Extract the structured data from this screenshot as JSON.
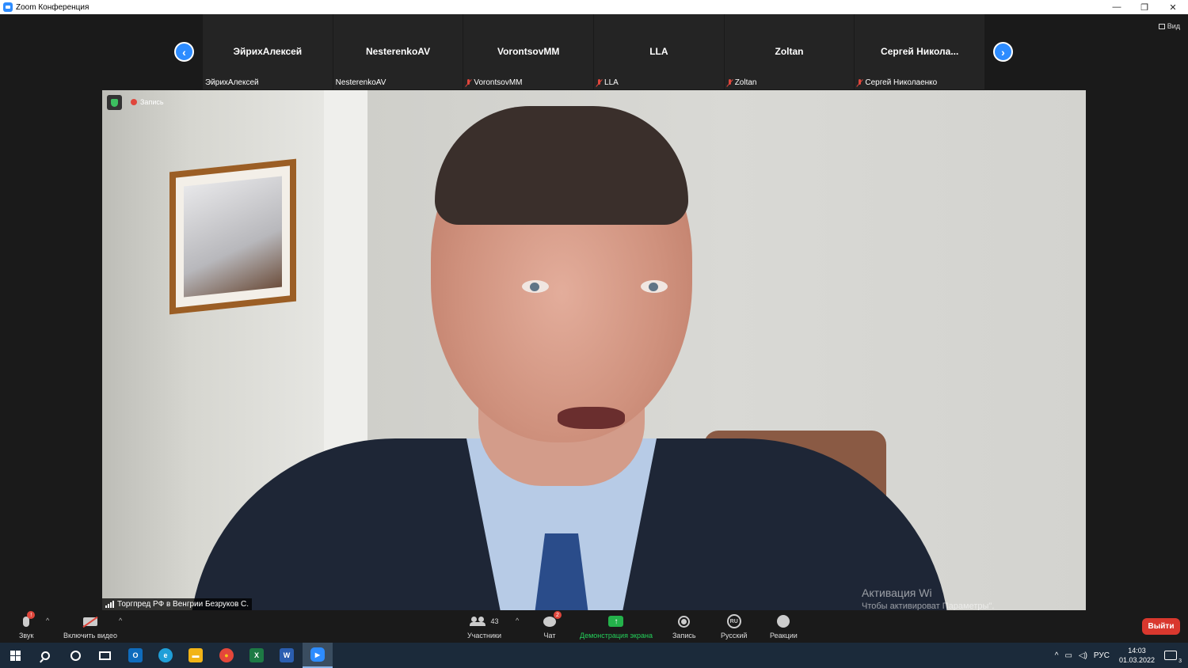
{
  "window": {
    "title": "Zoom Конференция",
    "controls": {
      "minimize": "—",
      "restore": "❐",
      "close": "✕"
    }
  },
  "gallery": {
    "view_label": "Вид",
    "prev_icon": "‹",
    "next_icon": "›",
    "participants": [
      {
        "display": "ЭйрихАлексей",
        "name": "ЭйрихАлексей",
        "muted": false
      },
      {
        "display": "NesterenkoAV",
        "name": "NesterenkoAV",
        "muted": false
      },
      {
        "display": "VorontsovMM",
        "name": "VorontsovMM",
        "muted": true
      },
      {
        "display": "LLA",
        "name": "LLA",
        "muted": true
      },
      {
        "display": "Zoltan",
        "name": "Zoltan",
        "muted": true
      },
      {
        "display": "Сергей Никола...",
        "name": "Сергей Николаенко",
        "muted": true
      }
    ]
  },
  "main_video": {
    "recording_label": "Запись",
    "speaker_name": "Торгпред РФ в Венгрии Безруков С."
  },
  "watermark": {
    "line1": "Активация Wi",
    "line2": "Чтобы активироват                               Параметры\"."
  },
  "toolbar": {
    "audio": {
      "label": "Звук",
      "badge": "!"
    },
    "video": {
      "label": "Включить видео"
    },
    "participants": {
      "label": "Участники",
      "count": "43"
    },
    "chat": {
      "label": "Чат",
      "badge": "2"
    },
    "share": {
      "label": "Демонстрация экрана",
      "icon": "↑"
    },
    "record": {
      "label": "Запись"
    },
    "language": {
      "label": "Русский",
      "icon_text": "RU"
    },
    "reactions": {
      "label": "Реакции"
    },
    "leave": {
      "label": "Выйти"
    },
    "caret": "^"
  },
  "taskbar": {
    "apps": [
      {
        "name": "outlook",
        "letter": "O",
        "color": "#0f6cbd"
      },
      {
        "name": "edge",
        "letter": "e",
        "color": "#1f9fd8"
      },
      {
        "name": "explorer",
        "letter": "▬",
        "color": "#f2b417"
      },
      {
        "name": "chrome",
        "letter": "●",
        "color": "#e4473a"
      },
      {
        "name": "excel",
        "letter": "X",
        "color": "#1d7a44"
      },
      {
        "name": "word",
        "letter": "W",
        "color": "#2b5eb0"
      },
      {
        "name": "zoom",
        "letter": "▶",
        "color": "#2d8cff"
      }
    ],
    "tray": {
      "chevron": "^",
      "language": "РУС",
      "time": "14:03",
      "date": "01.03.2022",
      "notifications": "3"
    }
  },
  "colors": {
    "accent": "#2d8cff",
    "share_green": "#24b24b",
    "leave_red": "#d9382e",
    "muted_red": "#e0463c"
  }
}
